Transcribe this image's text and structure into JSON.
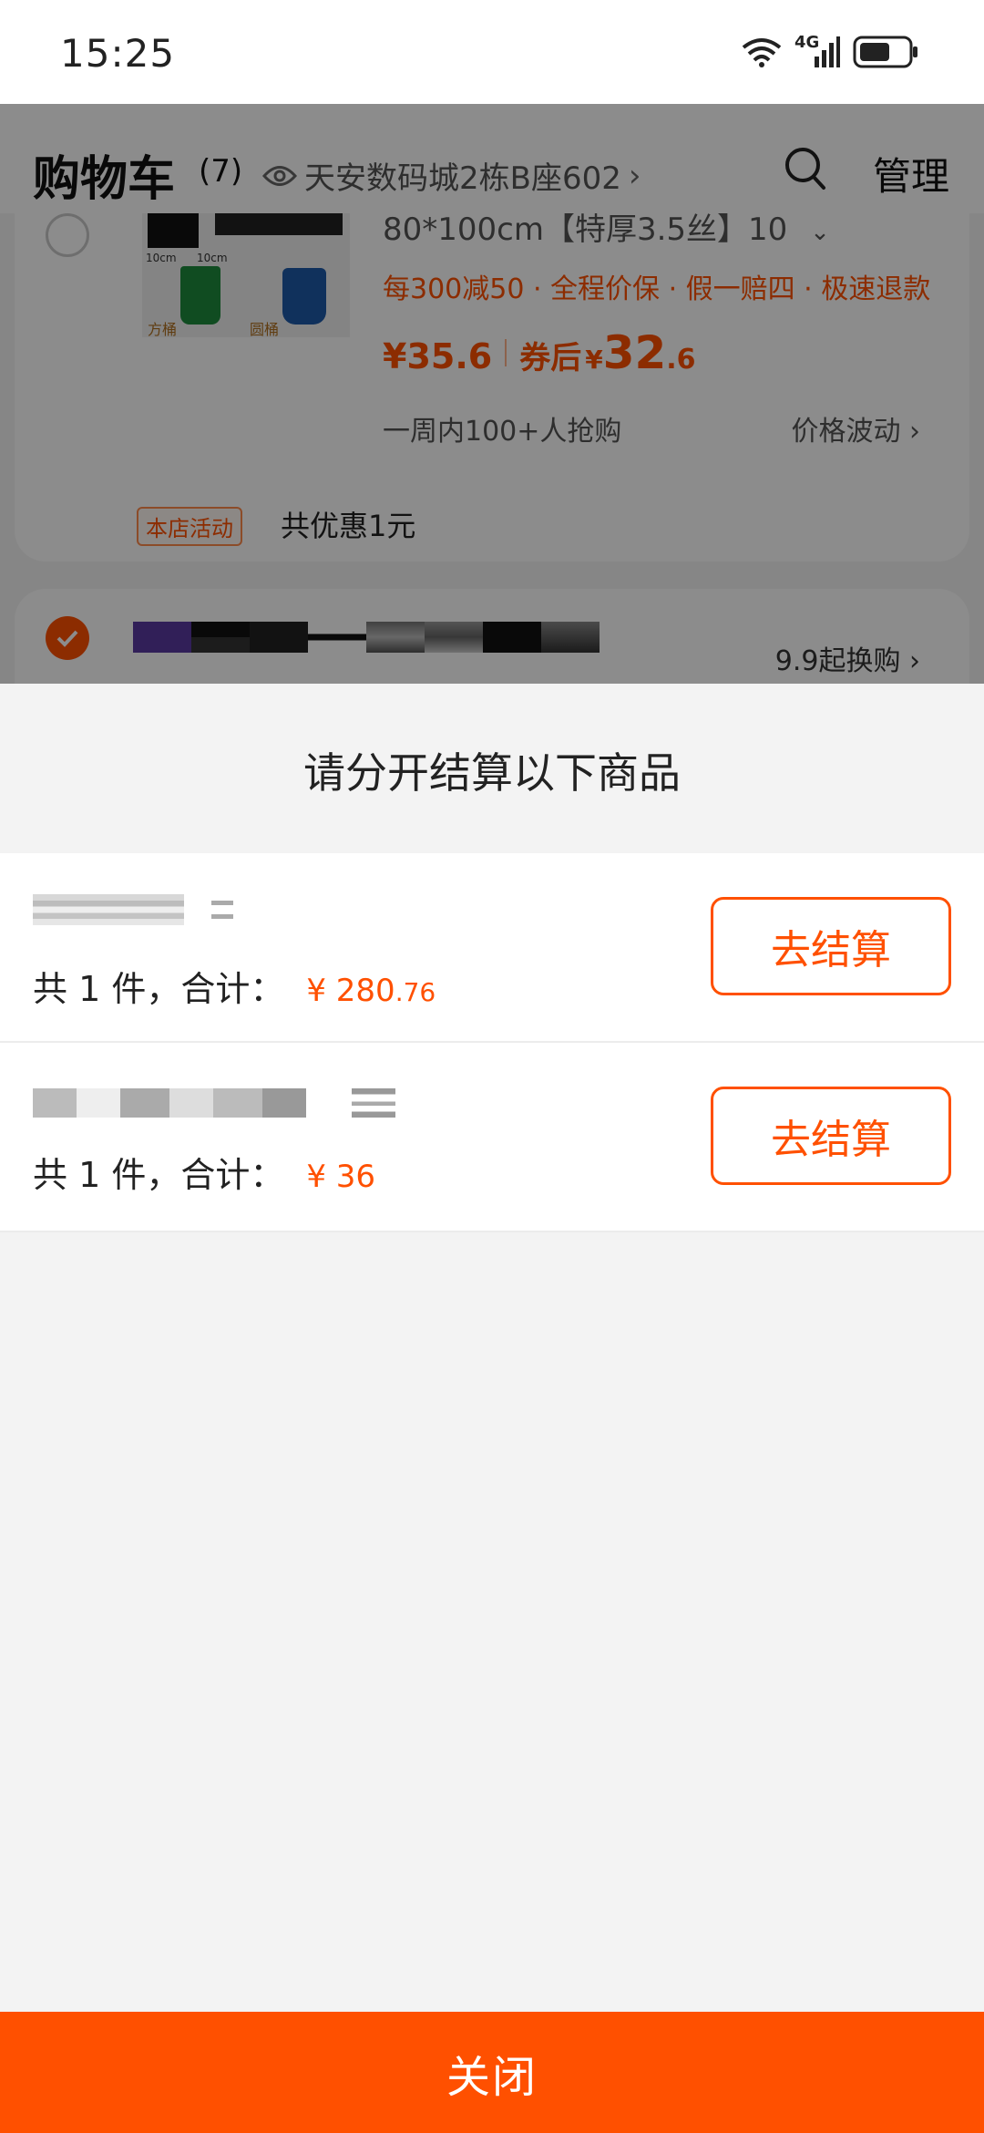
{
  "status_bar": {
    "time": "15:25",
    "network_label": "4G",
    "icons": [
      "wifi-icon",
      "signal-icon",
      "battery-icon"
    ]
  },
  "header": {
    "title": "购物车",
    "count": "(7)",
    "address": "天安数码城2栋B座602",
    "manage_label": "管理",
    "icons": [
      "eye-icon",
      "chevron-right-icon",
      "search-icon"
    ]
  },
  "background_cart": {
    "item": {
      "spec": "80*100cm【特厚3.5丝】10",
      "promotions": "每300减50 · 全程价保 · 假一赔四 · 极速退款",
      "price": "¥35.6",
      "coupon_label": "券后",
      "coupon_currency": "¥",
      "coupon_price_int": "32",
      "coupon_price_dec": ".6",
      "hot_text": "一周内100+人抢购",
      "fluctuation_label": "价格波动",
      "image_labels": [
        "10cm",
        "10cm",
        "方桶",
        "圆桶"
      ]
    },
    "activity_tag": "本店活动",
    "activity_text": "共优惠1元",
    "next_shop_swap": "9.9起换购"
  },
  "sheet": {
    "title": "请分开结算以下商品",
    "groups": [
      {
        "summary_label": "共 1 件，合计：",
        "currency": "¥",
        "amount_int": "280",
        "amount_dec": ".76",
        "button_label": "去结算"
      },
      {
        "summary_label": "共 1 件，合计：",
        "currency": "¥",
        "amount_int": "36",
        "amount_dec": "",
        "button_label": "去结算"
      }
    ],
    "close_label": "关闭"
  },
  "colors": {
    "accent": "#ff5000",
    "overlay": "rgba(0,0,0,0.45)",
    "sheet_bg": "#f3f3f3"
  }
}
